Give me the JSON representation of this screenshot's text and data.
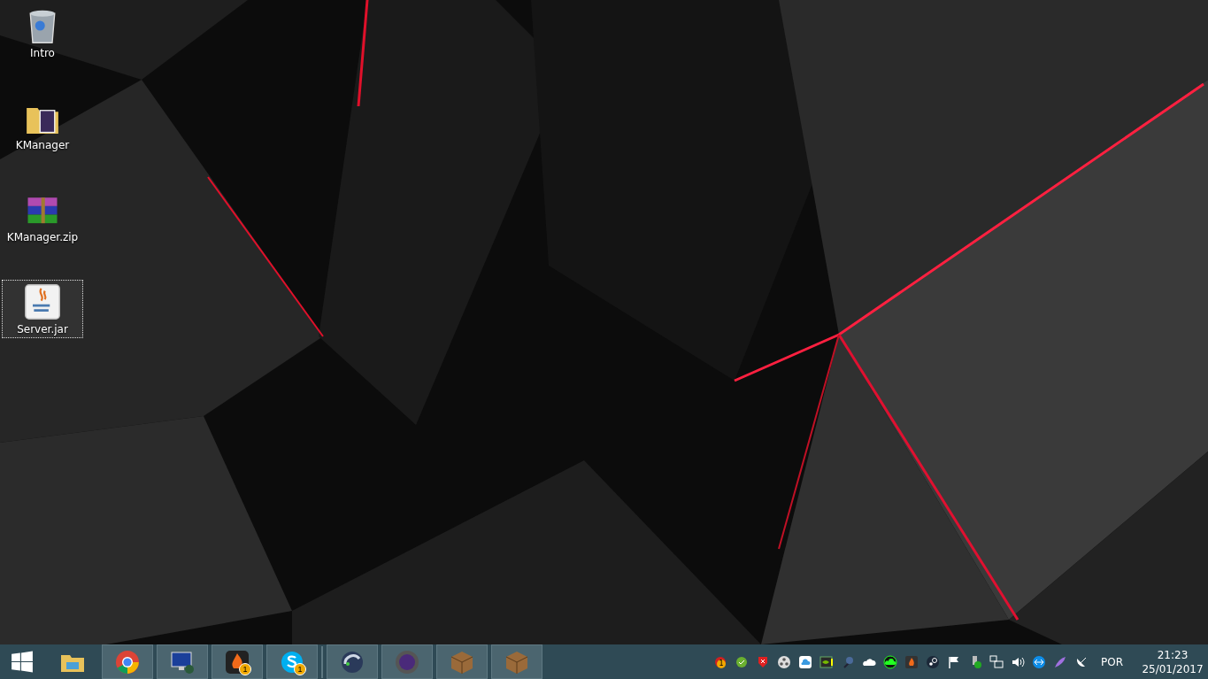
{
  "desktop_icons": [
    {
      "label": "Intro",
      "selected": false
    },
    {
      "label": "KManager",
      "selected": false
    },
    {
      "label": "KManager.zip",
      "selected": false
    },
    {
      "label": "Server.jar",
      "selected": true
    }
  ],
  "taskbar": {
    "apps": [
      {
        "running": false
      },
      {
        "running": true
      },
      {
        "running": true
      },
      {
        "running": true,
        "badge": "1"
      },
      {
        "running": true,
        "badge": "1"
      },
      {
        "running": true
      },
      {
        "running": true
      },
      {
        "running": true
      },
      {
        "running": true
      }
    ],
    "tray": {
      "badge": "1",
      "language": "POR",
      "time": "21:23",
      "date": "25/01/2017"
    }
  }
}
